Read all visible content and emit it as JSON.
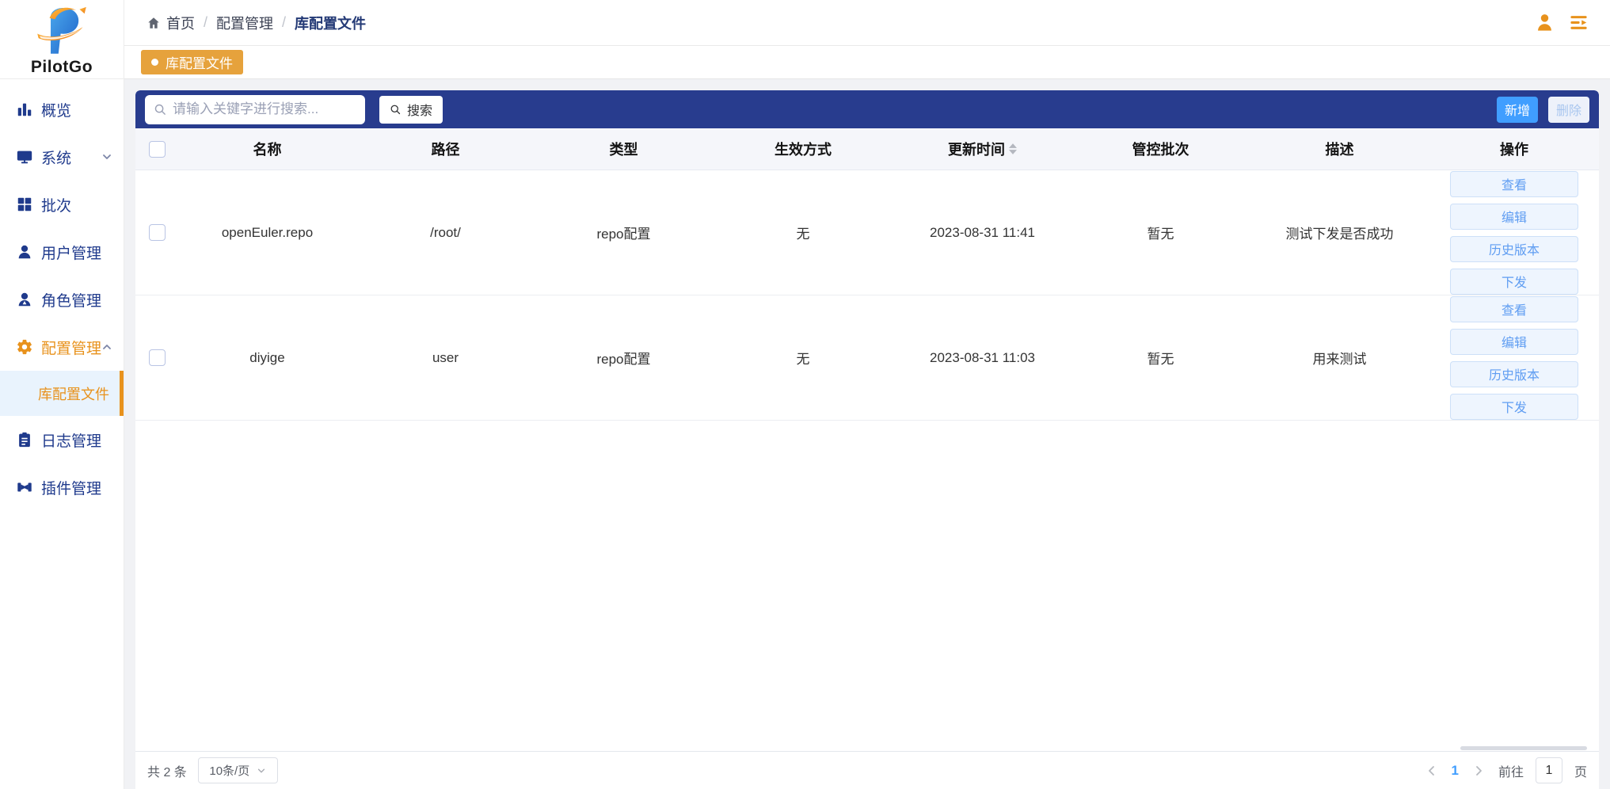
{
  "brand": {
    "name": "PilotGo"
  },
  "breadcrumb": {
    "items": [
      "首页",
      "配置管理",
      "库配置文件"
    ]
  },
  "tab": {
    "label": "库配置文件"
  },
  "sidebar": {
    "items": [
      {
        "label": "概览",
        "icon": "chart-icon"
      },
      {
        "label": "系统",
        "icon": "monitor-icon",
        "chevron": "down"
      },
      {
        "label": "批次",
        "icon": "grid-icon"
      },
      {
        "label": "用户管理",
        "icon": "user-icon"
      },
      {
        "label": "角色管理",
        "icon": "role-icon"
      },
      {
        "label": "配置管理",
        "icon": "gear-icon",
        "chevron": "up",
        "active": true
      },
      {
        "label": "日志管理",
        "icon": "log-icon"
      },
      {
        "label": "插件管理",
        "icon": "plugin-icon"
      }
    ],
    "submenu": {
      "label": "库配置文件",
      "active": true
    }
  },
  "toolbar": {
    "search_placeholder": "请输入关键字进行搜索...",
    "search_label": "搜索",
    "add_label": "新增",
    "delete_label": "删除"
  },
  "table": {
    "headers": [
      "名称",
      "路径",
      "类型",
      "生效方式",
      "更新时间",
      "管控批次",
      "描述",
      "操作"
    ],
    "rows": [
      {
        "name": "openEuler.repo",
        "path": "/root/",
        "type": "repo配置",
        "effect": "无",
        "updated": "2023-08-31 11:41",
        "batch": "暂无",
        "desc": "测试下发是否成功"
      },
      {
        "name": "diyige",
        "path": "user",
        "type": "repo配置",
        "effect": "无",
        "updated": "2023-08-31 11:03",
        "batch": "暂无",
        "desc": "用来测试"
      }
    ],
    "actions": [
      "查看",
      "编辑",
      "历史版本",
      "下发"
    ]
  },
  "pagination": {
    "total": "共 2 条",
    "page_size": "10条/页",
    "current_page": "1",
    "goto_label": "前往",
    "goto_value": "1",
    "page_unit": "页"
  },
  "colors": {
    "toolbar_navy": "#283c8e",
    "sidebar_text_navy": "#1f3a8c",
    "accent_orange": "#e8921c",
    "tab_orange": "#e6a23c",
    "primary_blue": "#409eff",
    "action_btn_text": "#5f9df2"
  }
}
